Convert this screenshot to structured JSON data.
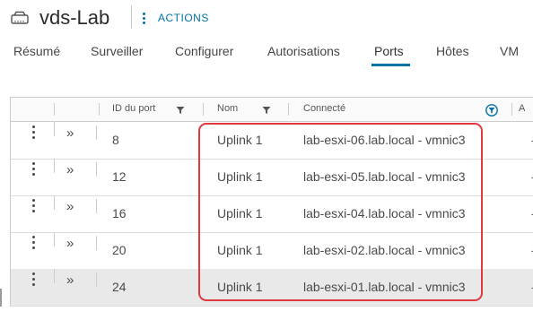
{
  "header": {
    "title": "vds-Lab",
    "actions_label": "ACTIONS"
  },
  "tabs": [
    {
      "label": "Résumé"
    },
    {
      "label": "Surveiller"
    },
    {
      "label": "Configurer"
    },
    {
      "label": "Autorisations"
    },
    {
      "label": "Ports"
    },
    {
      "label": "Hôtes"
    },
    {
      "label": "VM"
    }
  ],
  "active_tab": "Ports",
  "grid": {
    "columns": {
      "port_id": "ID du port",
      "name": "Nom",
      "connected": "Connecté",
      "next": "A"
    },
    "rows": [
      {
        "port_id": "8",
        "name": "Uplink 1",
        "connected": "lab-esxi-06.lab.local - vmnic3",
        "extra": "-"
      },
      {
        "port_id": "12",
        "name": "Uplink 1",
        "connected": "lab-esxi-05.lab.local - vmnic3",
        "extra": "-"
      },
      {
        "port_id": "16",
        "name": "Uplink 1",
        "connected": "lab-esxi-04.lab.local - vmnic3",
        "extra": "-"
      },
      {
        "port_id": "20",
        "name": "Uplink 1",
        "connected": "lab-esxi-02.lab.local - vmnic3",
        "extra": "-"
      },
      {
        "port_id": "24",
        "name": "Uplink 1",
        "connected": "lab-esxi-01.lab.local - vmnic3",
        "extra": "-"
      }
    ],
    "selected_row_index": 4
  },
  "colors": {
    "accent": "#0072a3",
    "highlight": "#e0393e",
    "selected_row": "#e9e9e9"
  }
}
